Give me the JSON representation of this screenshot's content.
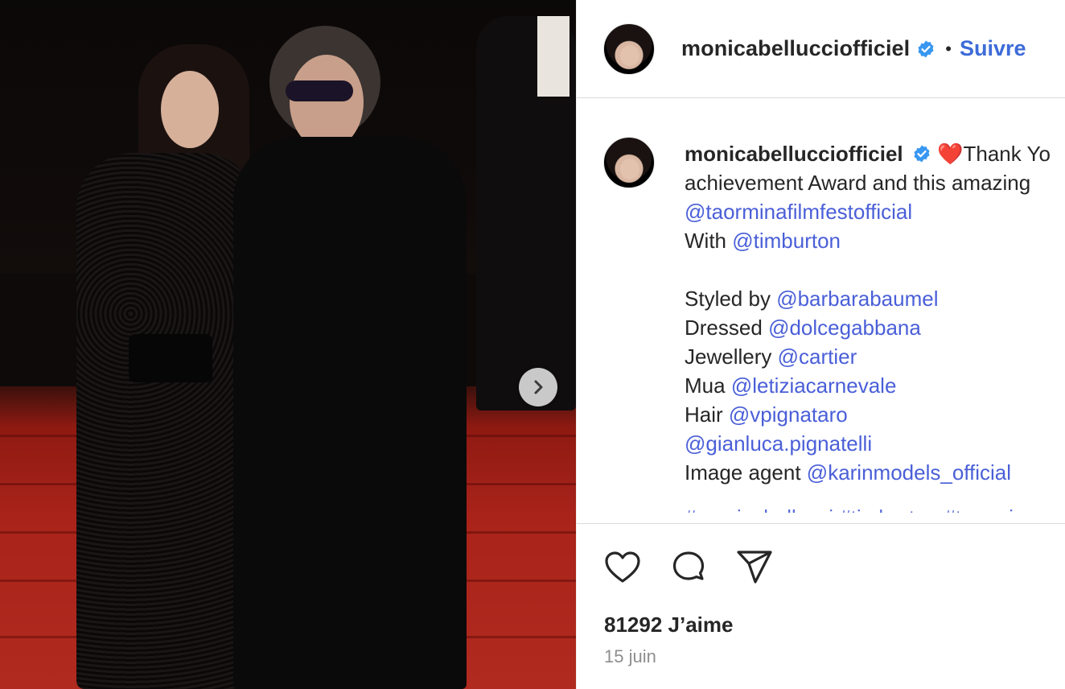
{
  "post": {
    "next_label": "Next",
    "image_alt": "Photo"
  },
  "header": {
    "username": "monicabellucciofficiel",
    "separator": "•",
    "follow_label": "Suivre"
  },
  "caption": {
    "author": "monicabellucciofficiel",
    "heart": "❤️",
    "lines": [
      "Thank Yo",
      "achievement Award and this amazing"
    ],
    "mention_festival": "@taorminafilmfestofficial",
    "with_label": "With",
    "mention_with": "@timburton",
    "credits": [
      {
        "label": "Styled by",
        "mention": "@barbarabaumel"
      },
      {
        "label": "Dressed",
        "mention": "@dolcegabbana"
      },
      {
        "label": "Jewellery",
        "mention": "@cartier"
      },
      {
        "label": "Mua",
        "mention": "@letiziacarnevale"
      },
      {
        "label": "Hair",
        "mention": "@vpignataro"
      },
      {
        "label": "",
        "mention": "@gianluca.pignatelli"
      },
      {
        "label": "Image agent",
        "mention": "@karinmodels_official"
      }
    ],
    "hashtags": "#monicabellucci #timburton #taormina"
  },
  "footer": {
    "likes": "81292 J’aime",
    "date": "15 juin"
  },
  "colors": {
    "link": "#4a5fd8",
    "follow": "#3d6bd8",
    "verified": "#3897f0",
    "text": "#262626",
    "muted": "#8e8e8e"
  },
  "icons": {
    "like": "heart-icon",
    "comment": "comment-icon",
    "share": "paper-plane-icon",
    "verified": "verified-badge-icon",
    "next": "chevron-right-icon"
  }
}
